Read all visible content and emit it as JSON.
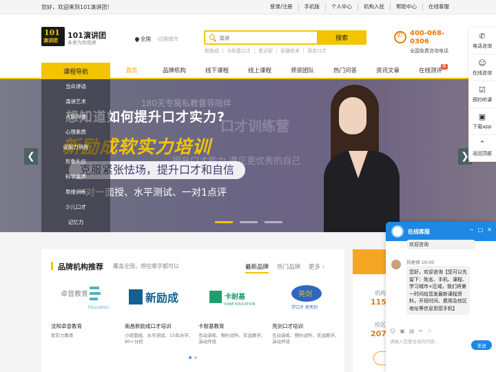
{
  "topbar": {
    "welcome": "您好，欢迎来到101演讲团！",
    "links": [
      "登录/注册",
      "手机版",
      "个人中心",
      "机构入驻",
      "帮助中心",
      "在线客服"
    ]
  },
  "header": {
    "logo_mark_1": "101",
    "logo_mark_2": "演讲团",
    "brand_name": "101演讲团",
    "slogan": "未来为你而来",
    "city": "全国",
    "switch_city": "切换城市",
    "search_placeholder": "演讲",
    "search_button": "搜索",
    "hot_words": [
      "新励成",
      "卡耐基口才",
      "思训家",
      "张珊就来",
      "语言口才"
    ],
    "phone": "400-068-0306",
    "phone_note": "全国免费咨询电话"
  },
  "nav": {
    "guide": "课程导航",
    "items": [
      "首页",
      "品牌机构",
      "线下课程",
      "线上课程",
      "师资团队",
      "热门问答",
      "资讯文章",
      "在线测评"
    ],
    "badge": "热"
  },
  "course_menu": [
    "当众讲话",
    "演讲艺术",
    "人际沟通",
    "心理素质",
    "说服力销售",
    "形象礼仪",
    "科学发声",
    "思维训练",
    "少儿口才",
    "记忆力"
  ],
  "banner": {
    "ghost_line_1": "180天专属私教督导陪伴",
    "ghost_line_2": "口才训练营",
    "ghost_line_3": "提升口才能力  遇见更优秀的自己",
    "headline": "想知道如何提升口才实力?",
    "brand_line": "新励成软实力培训",
    "pill": "克服紧张怯场，提升口才和自信",
    "subline": "一对一面授、水平测试、一对1点评",
    "prev": "❮",
    "next": "❯"
  },
  "sidebar": [
    {
      "icon": "✆",
      "label": "电话咨询"
    },
    {
      "icon": "☺",
      "label": "在线咨询"
    },
    {
      "icon": "☑",
      "label": "预约听课"
    },
    {
      "icon": "▣",
      "label": "下载app"
    },
    {
      "icon": "⌃",
      "label": "返回顶部"
    }
  ],
  "brand_section": {
    "title": "品牌机构推荐",
    "subtitle": "覆盖全国，想在哪学都可以",
    "tabs": [
      "最新品牌",
      "热门品牌"
    ],
    "more": "更多 ›",
    "cards": [
      {
        "logo_text": "卓音教育",
        "logo_sub": "Education",
        "name": "沈阳卓音教育",
        "desc": "软实力教育"
      },
      {
        "logo_text": "新励成",
        "name": "南昌新励成口才培训",
        "desc": "小班面授、水平测试、15年办学、80+分校"
      },
      {
        "logo_text": "卡耐基",
        "logo_sub": "KANE EDUCATION",
        "name": "卡耐基教育",
        "desc": "互动演练、预约试听、实战教学、演动开班"
      },
      {
        "logo_text": "亮剑",
        "logo_sub": "学口才 来亮剑",
        "name": "亮剑口才培训",
        "desc": "互动演练、预约试听、实战教学、演动开班"
      }
    ]
  },
  "right_panel": {
    "label_1": "机构",
    "num_1": "115",
    "label_2": "校区",
    "num_2": "207"
  },
  "chat": {
    "title": "在线客服",
    "greeting": "欢迎咨询",
    "agent": "刘老师",
    "time": "10:00",
    "message": "您好，欢迎咨询【您可以先留下：姓名、手机、课程、学习城市+区域，我们将第一时间给您发最新课程资料，开班时间、费用及校区地址等信息到您手机】",
    "input_placeholder": "请输入您要咨询的内容…",
    "send": "发送"
  },
  "colors": {
    "accent": "#f5c400",
    "phone": "#f07800",
    "chat_blue": "#1e88e5"
  }
}
